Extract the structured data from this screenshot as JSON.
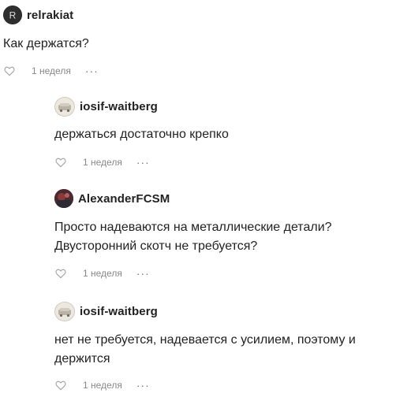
{
  "comments": [
    {
      "username": "relrakiat",
      "avatar_letter": "R",
      "text": "Как держатся?",
      "date": "1 неделя",
      "more": "···"
    },
    {
      "username": "iosif-waitberg",
      "text": "держаться достаточно крепко",
      "date": "1 неделя",
      "more": "···"
    },
    {
      "username": "AlexanderFCSM",
      "text_line1": "Просто надеваются на металлические детали?",
      "text_line2": "Двусторонний скотч не требуется?",
      "date": "1 неделя",
      "more": "···"
    },
    {
      "username": "iosif-waitberg",
      "text_line1": "нет не требуется, надевается с усилием, поэтому и",
      "text_line2": "держится",
      "date": "1 неделя",
      "more": "···"
    }
  ]
}
